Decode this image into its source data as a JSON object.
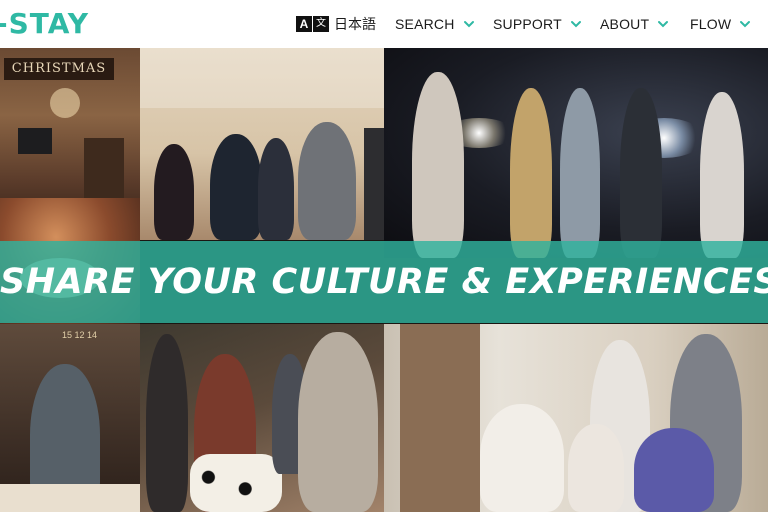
{
  "header": {
    "logo": "-STAY",
    "language": {
      "icon": "translate-icon",
      "label": "日本語"
    },
    "nav": [
      {
        "label": "SEARCH",
        "icon": "chevron-down-icon"
      },
      {
        "label": "SUPPORT",
        "icon": "chevron-down-icon"
      },
      {
        "label": "ABOUT",
        "icon": "chevron-down-icon"
      },
      {
        "label": "FLOW",
        "icon": "chevron-down-icon"
      }
    ]
  },
  "hero": {
    "headline": "SHARE YOUR CULTURE & EXPERIENCES",
    "photo_text": {
      "banner": "CHRISTMAS",
      "timestamp": "15 12 14"
    }
  },
  "colors": {
    "brand": "#2fb9a4",
    "banner_overlay": "#30b29e",
    "text": "#1b1b1b"
  }
}
